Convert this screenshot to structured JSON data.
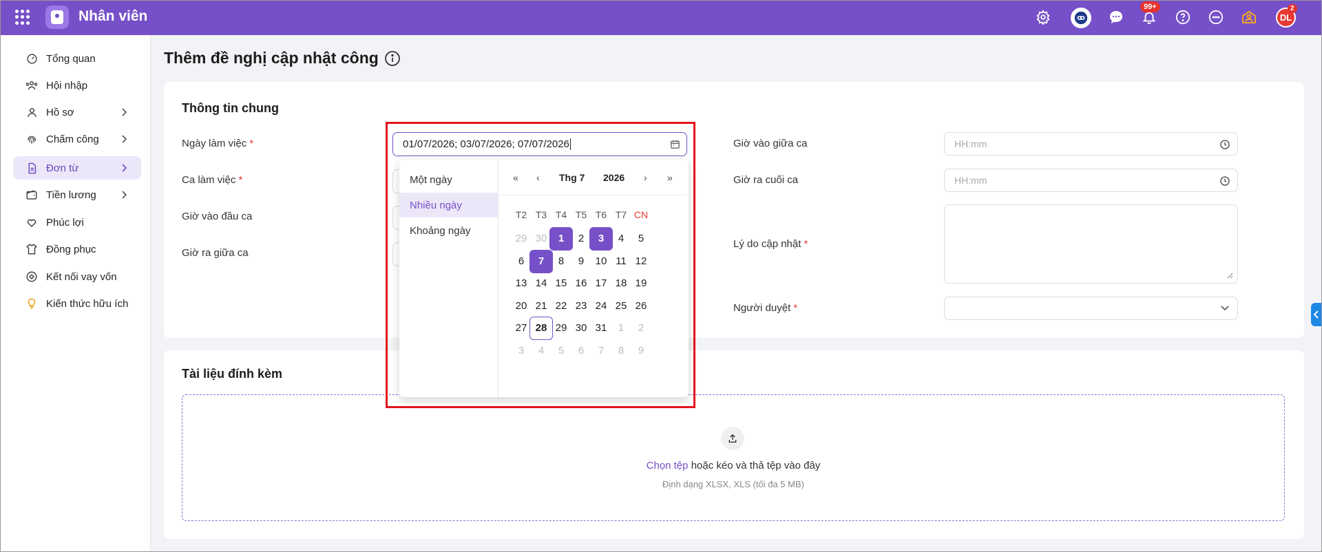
{
  "app": {
    "title": "Nhân viên",
    "notif_badge": "99+",
    "avatar_initials": "DL",
    "avatar_badge": "2"
  },
  "sidebar": {
    "items": [
      {
        "label": "Tổng quan",
        "icon": "dashboard-icon"
      },
      {
        "label": "Hội nhập",
        "icon": "users-icon"
      },
      {
        "label": "Hồ sơ",
        "icon": "user-icon"
      },
      {
        "label": "Chấm công",
        "icon": "fingerprint-icon"
      },
      {
        "label": "Đơn từ",
        "icon": "document-icon",
        "active": true
      },
      {
        "label": "Tiền lương",
        "icon": "wallet-icon"
      },
      {
        "label": "Phúc lợi",
        "icon": "heart-hand-icon"
      },
      {
        "label": "Đồng phục",
        "icon": "shirt-icon"
      },
      {
        "label": "Kết nối vay vốn",
        "icon": "loan-icon"
      },
      {
        "label": "Kiến thức hữu ích",
        "icon": "lightbulb-icon"
      }
    ]
  },
  "page": {
    "title": "Thêm đề nghị cập nhật công"
  },
  "general": {
    "title": "Thông tin chung",
    "work_date_label": "Ngày làm việc",
    "work_date_value": "01/07/2026; 03/07/2026; 07/07/2026",
    "shift_label": "Ca làm việc",
    "shift_start_label": "Giờ vào đầu ca",
    "mid_out_label": "Giờ ra giữa ca",
    "mid_in_label": "Giờ vào giữa ca",
    "mid_in_placeholder": "HH:mm",
    "end_out_label": "Giờ ra cuối ca",
    "end_out_placeholder": "HH:mm",
    "reason_label": "Lý do cập nhật",
    "approver_label": "Người duyệt",
    "required_mark": "*"
  },
  "attachments": {
    "title": "Tài liệu đính kèm",
    "choose_link": "Chọn tệp",
    "drop_text": " hoặc kéo và thả tệp vào đây",
    "format_hint": "Định dạng XLSX, XLS (tối đa 5 MB)"
  },
  "datepicker": {
    "modes": [
      "Một ngày",
      "Nhiều ngày",
      "Khoảng ngày"
    ],
    "selected_mode": "Nhiều ngày",
    "month_label": "Thg 7",
    "year_label": "2026",
    "weekdays": [
      "T2",
      "T3",
      "T4",
      "T5",
      "T6",
      "T7",
      "CN"
    ],
    "weeks": [
      [
        "29",
        "30",
        "1",
        "2",
        "3",
        "4",
        "5"
      ],
      [
        "6",
        "7",
        "8",
        "9",
        "10",
        "11",
        "12"
      ],
      [
        "13",
        "14",
        "15",
        "16",
        "17",
        "18",
        "19"
      ],
      [
        "20",
        "21",
        "22",
        "23",
        "24",
        "25",
        "26"
      ],
      [
        "27",
        "28",
        "29",
        "30",
        "31",
        "1",
        "2"
      ],
      [
        "3",
        "4",
        "5",
        "6",
        "7",
        "8",
        "9"
      ]
    ],
    "selected_days": [
      "1",
      "3",
      "7"
    ],
    "today": "28",
    "colors": {
      "accent": "#7650c8",
      "sunday": "#e53935",
      "highlight_box": "#e3141b"
    }
  }
}
